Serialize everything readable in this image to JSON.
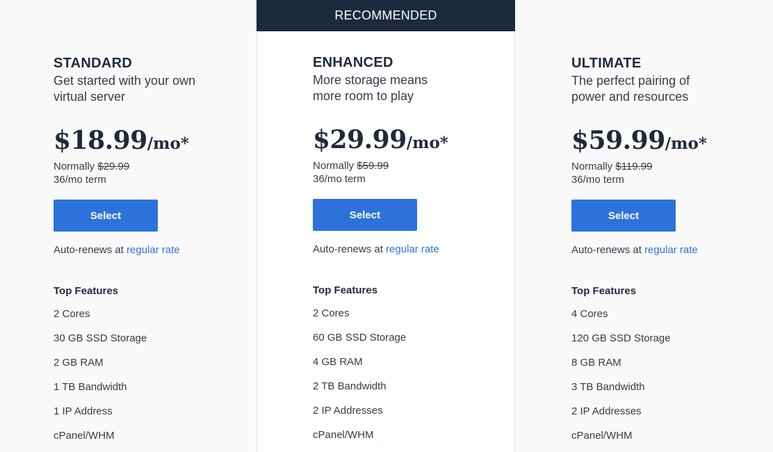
{
  "banner": {
    "label": "RECOMMENDED"
  },
  "common": {
    "normally_label": "Normally",
    "auto_renew_text": "Auto-renews at",
    "auto_renew_link": "regular rate",
    "features_title": "Top Features",
    "select_label": "Select"
  },
  "plans": [
    {
      "name": "STANDARD",
      "tagline": "Get started with your own virtual server",
      "price": "$18.99",
      "unit": "/mo*",
      "normal_price": "$29.99",
      "term": "36/mo term",
      "features": [
        "2 Cores",
        "30 GB SSD Storage",
        "2 GB RAM",
        "1 TB Bandwidth",
        "1 IP Address",
        "cPanel/WHM"
      ]
    },
    {
      "name": "ENHANCED",
      "tagline": "More storage means more room to play",
      "price": "$29.99",
      "unit": "/mo*",
      "normal_price": "$59.99",
      "term": "36/mo term",
      "features": [
        "2 Cores",
        "60 GB SSD Storage",
        "4 GB RAM",
        "2 TB Bandwidth",
        "2 IP Addresses",
        "cPanel/WHM"
      ]
    },
    {
      "name": "ULTIMATE",
      "tagline": "The perfect pairing of power and resources",
      "price": "$59.99",
      "unit": "/mo*",
      "normal_price": "$119.99",
      "term": "36/mo term",
      "features": [
        "4 Cores",
        "120 GB SSD Storage",
        "8 GB RAM",
        "3 TB Bandwidth",
        "2 IP Addresses",
        "cPanel/WHM"
      ]
    }
  ],
  "colors": {
    "banner_bg": "#1c2a3c",
    "accent": "#2d72db",
    "text_dark": "#1e2a3b"
  }
}
